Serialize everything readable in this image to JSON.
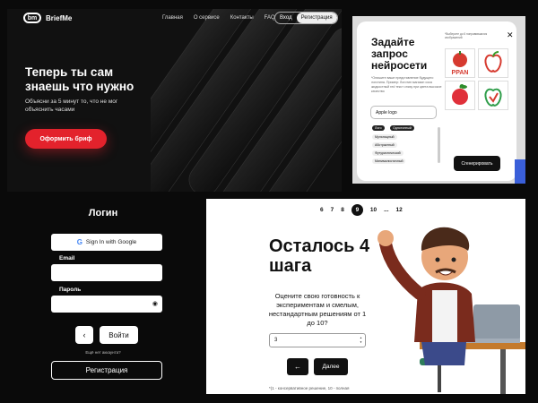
{
  "landing": {
    "brand": "BriefMe",
    "logo_glyph": "bm",
    "nav": [
      "Главная",
      "О сервисе",
      "Контакты",
      "FAQ"
    ],
    "login": "Вход",
    "register": "Регистрация",
    "hero_title": "Теперь ты сам знаешь что нужно",
    "hero_sub": "Объясни за 5 минут то, что не мог объяснить часами",
    "cta": "Оформить бриф"
  },
  "neuro": {
    "title": "Задайте запрос нейросети",
    "hint": "*Опишите ваше представление будущего логотипа. Пример: Логотип магазин сока жидкостный red текст снизу при цвета высокое качество",
    "right_label": "*Выберите до 6 понравившихся изображений",
    "input_value": "Apple logo",
    "tags": [
      "Лого",
      "Однотонный",
      "Мультящный",
      "Абстрактный",
      "Футуристический",
      "Минималистичный"
    ],
    "generate": "Сгенерировать",
    "tile_text": "PPAN"
  },
  "login": {
    "title": "Логин",
    "google": "Sign In with Google",
    "google_glyph": "G",
    "email_label": "Email",
    "password_label": "Пароль",
    "back_glyph": "‹",
    "submit": "Войти",
    "no_account": "Ещё нет аккаунта?",
    "register": "Регистрация"
  },
  "steps": {
    "items": [
      "6",
      "7",
      "8",
      "9",
      "10",
      "...",
      "12"
    ],
    "active": "9",
    "title": "Осталось 4 шага",
    "question": "Оцените свою готовность к экспериментам и смелым, нестандартным решениям от 1 до 10?",
    "answer_value": "3",
    "back_glyph": "←",
    "next": "Далее",
    "footnote": "*(1 - консервативное решение, 10 - полная"
  }
}
